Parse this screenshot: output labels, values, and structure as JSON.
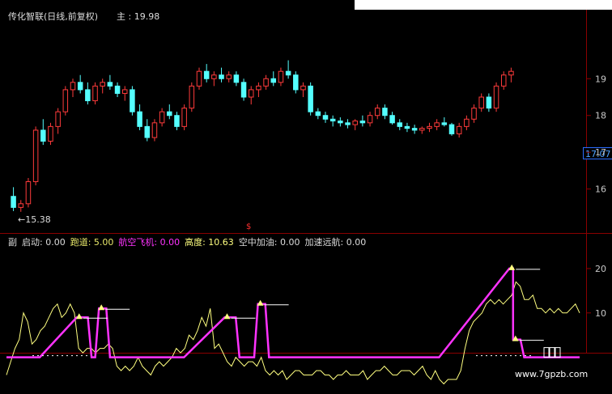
{
  "main_title": "传化智联(日线,前复权)",
  "main_label": "主",
  "main_value": "19.98",
  "low_marker": "15.38",
  "last_price": "17.07",
  "event_marker": "$",
  "sub_header": [
    {
      "label": "副",
      "value": "",
      "color": "#dcdcdc"
    },
    {
      "label": "启动",
      "value": "0.00",
      "color": "#dcdcdc"
    },
    {
      "label": "跑道",
      "value": "5.00",
      "color": "#e8e86a"
    },
    {
      "label": "航空飞机",
      "value": "0.00",
      "color": "#ff33ff"
    },
    {
      "label": "高度",
      "value": "10.63",
      "color": "#ffff80"
    },
    {
      "label": "空中加油",
      "value": "0.00",
      "color": "#dcdcdc"
    },
    {
      "label": "加速远航",
      "value": "0.00",
      "color": "#dcdcdc"
    }
  ],
  "watermark": "www.7gpzb.com",
  "colors": {
    "up": "#ff3b3b",
    "down": "#54ffff",
    "magenta": "#ff33ff",
    "yellow": "#ffff80",
    "grid": "#8a0000",
    "axis_text": "#c8c8c8",
    "price_tag": "#4ea0ff"
  },
  "chart_data": [
    {
      "type": "candlestick",
      "title": "传化智联(日线,前复权)",
      "y_ticks": [
        "19",
        "18",
        "17",
        "16"
      ],
      "ylim": [
        15.2,
        19.6
      ],
      "markers": {
        "high": 19.98,
        "low": 15.38,
        "last": 17.07
      },
      "ohlc": [
        [
          15.8,
          16.05,
          15.4,
          15.5
        ],
        [
          15.5,
          15.7,
          15.38,
          15.6
        ],
        [
          15.6,
          16.3,
          15.5,
          16.2
        ],
        [
          16.2,
          17.7,
          16.1,
          17.6
        ],
        [
          17.6,
          17.9,
          17.2,
          17.3
        ],
        [
          17.3,
          17.8,
          17.2,
          17.7
        ],
        [
          17.7,
          18.2,
          17.5,
          18.1
        ],
        [
          18.1,
          18.8,
          18.0,
          18.7
        ],
        [
          18.7,
          19.0,
          18.5,
          18.9
        ],
        [
          18.9,
          19.1,
          18.6,
          18.7
        ],
        [
          18.7,
          18.9,
          18.3,
          18.4
        ],
        [
          18.4,
          18.9,
          18.3,
          18.8
        ],
        [
          18.8,
          19.0,
          18.6,
          18.9
        ],
        [
          18.9,
          19.1,
          18.7,
          18.8
        ],
        [
          18.8,
          18.9,
          18.5,
          18.6
        ],
        [
          18.6,
          18.8,
          18.4,
          18.7
        ],
        [
          18.7,
          18.8,
          18.0,
          18.1
        ],
        [
          18.1,
          18.3,
          17.6,
          17.7
        ],
        [
          17.7,
          17.9,
          17.3,
          17.4
        ],
        [
          17.4,
          17.9,
          17.3,
          17.8
        ],
        [
          17.8,
          18.2,
          17.7,
          18.1
        ],
        [
          18.1,
          18.3,
          17.9,
          18.0
        ],
        [
          18.0,
          18.1,
          17.6,
          17.7
        ],
        [
          17.7,
          18.3,
          17.6,
          18.2
        ],
        [
          18.2,
          18.9,
          18.1,
          18.8
        ],
        [
          18.8,
          19.3,
          18.7,
          19.2
        ],
        [
          19.2,
          19.4,
          18.9,
          19.0
        ],
        [
          19.0,
          19.2,
          18.8,
          19.1
        ],
        [
          19.1,
          19.3,
          18.9,
          19.0
        ],
        [
          19.0,
          19.2,
          18.9,
          19.1
        ],
        [
          19.1,
          19.2,
          18.8,
          18.9
        ],
        [
          18.9,
          19.0,
          18.4,
          18.5
        ],
        [
          18.5,
          18.8,
          18.3,
          18.7
        ],
        [
          18.7,
          18.9,
          18.5,
          18.8
        ],
        [
          18.8,
          19.1,
          18.7,
          19.0
        ],
        [
          19.0,
          19.2,
          18.8,
          18.9
        ],
        [
          18.9,
          19.3,
          18.8,
          19.2
        ],
        [
          19.2,
          19.5,
          19.0,
          19.1
        ],
        [
          19.1,
          19.2,
          18.6,
          18.7
        ],
        [
          18.7,
          18.9,
          18.5,
          18.8
        ],
        [
          18.8,
          18.9,
          18.0,
          18.1
        ],
        [
          18.1,
          18.2,
          17.9,
          18.0
        ],
        [
          18.0,
          18.1,
          17.8,
          17.9
        ],
        [
          17.9,
          18.0,
          17.7,
          17.85
        ],
        [
          17.85,
          17.95,
          17.7,
          17.8
        ],
        [
          17.8,
          17.9,
          17.65,
          17.75
        ],
        [
          17.75,
          17.9,
          17.6,
          17.85
        ],
        [
          17.85,
          18.0,
          17.7,
          17.8
        ],
        [
          17.8,
          18.1,
          17.7,
          18.0
        ],
        [
          18.0,
          18.3,
          17.9,
          18.2
        ],
        [
          18.2,
          18.3,
          17.9,
          18.0
        ],
        [
          18.0,
          18.1,
          17.75,
          17.8
        ],
        [
          17.8,
          17.9,
          17.6,
          17.7
        ],
        [
          17.7,
          17.8,
          17.55,
          17.65
        ],
        [
          17.65,
          17.75,
          17.5,
          17.6
        ],
        [
          17.6,
          17.7,
          17.5,
          17.65
        ],
        [
          17.65,
          17.8,
          17.55,
          17.7
        ],
        [
          17.7,
          17.9,
          17.6,
          17.8
        ],
        [
          17.8,
          17.95,
          17.7,
          17.75
        ],
        [
          17.75,
          17.8,
          17.45,
          17.5
        ],
        [
          17.5,
          17.8,
          17.4,
          17.7
        ],
        [
          17.7,
          18.0,
          17.6,
          17.9
        ],
        [
          17.9,
          18.3,
          17.8,
          18.2
        ],
        [
          18.2,
          18.6,
          18.1,
          18.5
        ],
        [
          18.5,
          18.6,
          18.1,
          18.2
        ],
        [
          18.2,
          18.9,
          18.1,
          18.8
        ],
        [
          18.8,
          19.2,
          18.7,
          19.1
        ],
        [
          19.1,
          19.3,
          18.9,
          19.2
        ]
      ]
    },
    {
      "type": "line",
      "title": "副",
      "y_ticks": [
        "20",
        "10"
      ],
      "ylim": [
        -7,
        24
      ],
      "series": [
        {
          "name": "高度",
          "color": "#ffff80",
          "values": [
            -4,
            -1,
            2,
            4,
            10,
            8,
            3,
            4,
            6,
            7,
            9,
            11,
            12,
            9,
            10,
            12,
            10,
            2,
            1,
            2,
            2,
            1,
            2,
            2,
            3,
            2,
            -2,
            -3,
            -2,
            -3,
            -2,
            0,
            -2,
            -3,
            -4,
            -2,
            -1,
            -2,
            -1,
            0,
            2,
            1,
            2,
            5,
            4,
            6,
            9,
            7,
            11,
            2,
            3,
            1,
            -1,
            -2,
            0,
            -1,
            -2,
            -1,
            -1,
            -2,
            0,
            -3,
            -4,
            -3,
            -4,
            -3,
            -5,
            -4,
            -3,
            -3,
            -4,
            -4,
            -4,
            -3,
            -3,
            -4,
            -4,
            -5,
            -4,
            -4,
            -3,
            -4,
            -4,
            -4,
            -3,
            -5,
            -4,
            -3,
            -3,
            -2,
            -3,
            -4,
            -4,
            -3,
            -3,
            -3,
            -4,
            -3,
            -2,
            -4,
            -5,
            -3,
            -5,
            -6,
            -5,
            -5,
            -5,
            -3,
            2,
            6,
            8,
            9,
            10,
            12,
            13,
            12,
            13,
            12,
            13,
            14,
            17,
            16,
            13,
            13,
            14,
            11,
            11,
            10,
            11,
            10,
            11,
            10,
            10,
            11,
            12,
            10
          ],
          "x_start": 0,
          "x_end": 136
        },
        {
          "name": "航空飞机",
          "color": "#ff33ff",
          "points": [
            [
              0,
              0
            ],
            [
              9,
              0
            ],
            [
              19,
              9
            ],
            [
              22,
              9
            ],
            [
              23,
              0
            ],
            [
              24,
              0
            ],
            [
              25,
              11
            ],
            [
              27,
              11
            ],
            [
              28,
              0
            ],
            [
              48,
              0
            ],
            [
              59,
              9
            ],
            [
              62,
              9
            ],
            [
              63,
              0
            ],
            [
              67,
              0
            ],
            [
              68,
              12
            ],
            [
              70,
              12
            ],
            [
              71,
              0
            ],
            [
              117,
              0
            ],
            [
              136,
              20
            ],
            [
              137,
              20
            ],
            [
              137,
              4
            ],
            [
              139,
              4
            ],
            [
              140,
              0
            ],
            [
              155,
              0
            ]
          ]
        }
      ]
    }
  ]
}
